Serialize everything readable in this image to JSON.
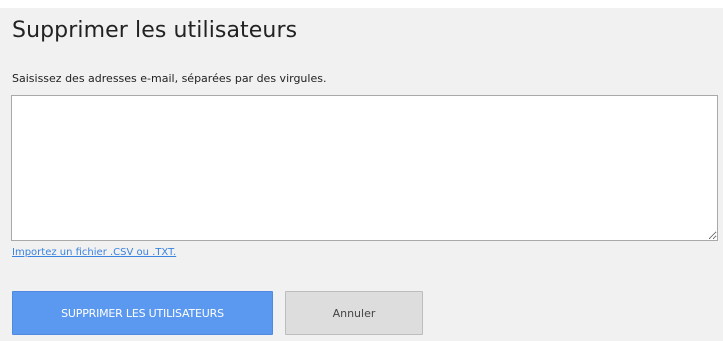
{
  "dialog": {
    "title": "Supprimer les utilisateurs",
    "instruction": "Saisissez des adresses e-mail, séparées par des virgules.",
    "emails_value": "",
    "import_link": "Importez un fichier .CSV ou .TXT.",
    "primary_button": "SUPPRIMER LES UTILISATEURS",
    "cancel_button": "Annuler"
  },
  "colors": {
    "primary": "#5b99f0",
    "link": "#3b83e0",
    "background": "#f1f1f1"
  }
}
